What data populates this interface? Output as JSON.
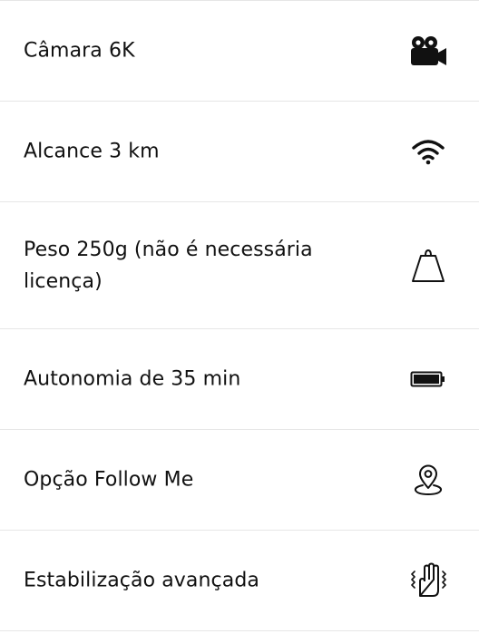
{
  "features": [
    {
      "label": "Câmara 6K",
      "icon": "video-camera-icon"
    },
    {
      "label": "Alcance 3 km",
      "icon": "wifi-signal-icon"
    },
    {
      "label": "Peso 250g (não é necessária licença)",
      "icon": "weight-icon"
    },
    {
      "label": "Autonomia de 35 min",
      "icon": "battery-icon"
    },
    {
      "label": "Opção Follow Me",
      "icon": "location-pin-icon"
    },
    {
      "label": "Estabilização avançada",
      "icon": "stabilization-hand-icon"
    }
  ]
}
